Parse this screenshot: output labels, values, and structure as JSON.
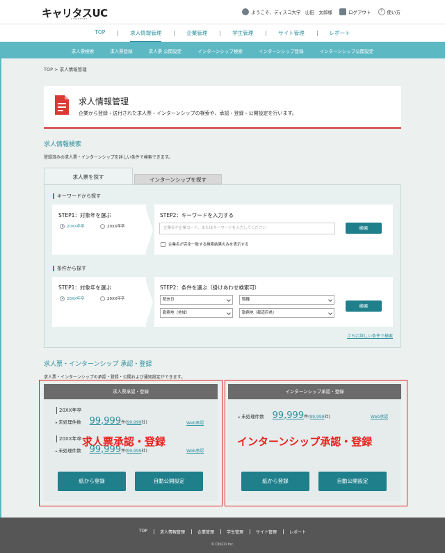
{
  "header": {
    "logo": "キャリタスUC",
    "logo_sub": "CONTENTS",
    "user_greeting": "ようこそ、ディスコ大学　山田　太郎様",
    "logout": "ログアウト",
    "help": "使い方"
  },
  "main_nav": [
    "TOP",
    "求人情報管理",
    "企業管理",
    "学生管理",
    "サイト管理",
    "レポート"
  ],
  "sub_nav": [
    "求人票検索",
    "求人票登録",
    "求人票 公開設定",
    "インターンシップ検索",
    "インターンシップ登録",
    "インターンシップ公開設定"
  ],
  "breadcrumb": "TOP > 求人情報管理",
  "page": {
    "title": "求人情報管理",
    "description": "企業から登録・送付された求人票・インターンシップの検索や、承認・登録・公開設定を行います。"
  },
  "search": {
    "heading": "求人情報検索",
    "description": "登録済みの求人票・インターンシップを詳しい条件で検索できます。",
    "tab_jobs": "求人票を探す",
    "tab_intern": "インターンシップを探す",
    "keyword_group": "キーワードから探す",
    "step1": "STEP1：対象年を選ぶ",
    "year_a": "20XX年卒",
    "year_b": "20XX年卒",
    "step2_kw": "STEP2：キーワードを入力する",
    "kw_placeholder": "企業名や企業コード、またはキーワードを入力してください",
    "search_btn": "検索",
    "exact_match": "企業名が完全一致する検索結果のみを表示する",
    "cond_group": "条件から探す",
    "step2_cond": "STEP2：条件を選ぶ（掛けあわせ検索可）",
    "sel_1": "配信日",
    "sel_2": "職種",
    "sel_3": "勤務地（地域）",
    "sel_4": "勤務地（都道府県）",
    "more_link": "さらに詳しい条件で検索"
  },
  "approval": {
    "heading": "求人票・インターンシップ 承認・登録",
    "description": "求人票・インターンシップの承認・登録・公開および通知設定ができます。",
    "jobs_card": {
      "title": "求人票承認・登録",
      "year1": "20XX年卒",
      "year2": "20XX年卒",
      "pending_label": "未処理件数",
      "count1": "99,999",
      "count2": "99,999",
      "unit": "件",
      "companies1": "99,999",
      "companies2": "99,999",
      "web_link": "Web承認",
      "overlay": "求人票承認・登録",
      "paper_btn": "紙から登録",
      "auto_btn": "自動公開設定"
    },
    "intern_card": {
      "title": "インターンシップ承認・登録",
      "pending_label": "未処理件数",
      "count": "99,999",
      "unit": "件",
      "companies": "99,999",
      "web_link": "Web承認",
      "overlay": "インターンシップ承認・登録",
      "paper_btn": "紙から登録",
      "auto_btn": "自動公開設定"
    }
  },
  "footer": {
    "links": [
      "TOP",
      "求人情報管理",
      "企業管理",
      "学生管理",
      "サイト管理",
      "レポート"
    ],
    "copyright": "© DISCO Inc."
  },
  "colors": {
    "accent": "#2a8e9c",
    "subnav": "#5cb8c3",
    "alert": "#e0201e",
    "footer": "#565656"
  }
}
